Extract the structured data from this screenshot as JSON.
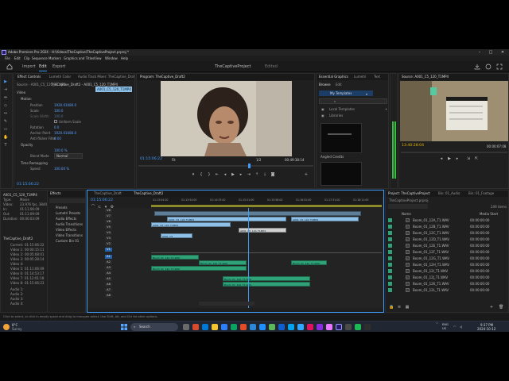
{
  "window": {
    "title": "Adobe Premiere Pro 2024 - H:\\Videos\\TheCaptive\\TheCaptiveProject.prproj *",
    "controls": [
      "–",
      "□",
      "✕"
    ]
  },
  "menu": [
    "File",
    "Edit",
    "Clip",
    "Sequence",
    "Markers",
    "Graphics and Titles",
    "View",
    "Window",
    "Help"
  ],
  "workspace": {
    "tabs": [
      "Import",
      "Edit",
      "Export"
    ],
    "active": "Edit",
    "project_title": "TheCaptiveProject",
    "status": "Edited"
  },
  "effect_controls": {
    "tabs": [
      "Effect Controls",
      "Lumetri Color",
      "Audio Track Mixer: TheCaptive_Draft"
    ],
    "source_label": "Source - A001_C5_120_T1.MP4",
    "sequence_label": "TheCaptive_Draft2 - A001_C5_120_T1MP4",
    "clip_name": "A001_C5_120_T1MP4",
    "section_video": "Video",
    "motion_label": "Motion",
    "rows": [
      {
        "label": "Position",
        "value": "1920.0",
        "value2": "1080.0"
      },
      {
        "label": "Scale",
        "value": "100.0"
      },
      {
        "label": "Scale Width",
        "value": "100.0"
      },
      {
        "label": "Uniform Scale",
        "value": ""
      },
      {
        "label": "Rotation",
        "value": "0.0"
      },
      {
        "label": "Anchor Point",
        "value": "1920.0",
        "value2": "1080.0"
      },
      {
        "label": "Anti-flicker Filter",
        "value": "0.00"
      }
    ],
    "opacity_label": "Opacity",
    "opacity_value": "100.0 %",
    "blend_label": "Blend Mode",
    "blend_value": "Normal",
    "remap_label": "Time Remapping",
    "speed_label": "Speed",
    "speed_value": "100.00 %",
    "timecode": "01:15:06:22"
  },
  "program": {
    "tab": "Program: TheCaptive_Draft2",
    "timecode": "01:15:06:22",
    "fit": "Fit",
    "fraction": "1/2",
    "duration": "00:49:38:14"
  },
  "essential_graphics": {
    "tabs": [
      "Essential Graphics",
      "Lumetri",
      "Text"
    ],
    "sub_tabs": [
      "Browse",
      "Edit"
    ],
    "my_templates": "My Templates",
    "folders": [
      "Local Templates",
      "Libraries"
    ],
    "templates": [
      "Angled Credits",
      "Angled Title"
    ]
  },
  "source": {
    "tab": "Source: A001_C5_120_T1MP4",
    "timecode": "13:40:28:04",
    "duration": "00:00:07:08"
  },
  "info": {
    "rows": [
      {
        "label": "A001_C5_120_T1MP4",
        "value": ""
      },
      {
        "label": "Type:",
        "value": "Movie"
      },
      {
        "label": "Video:",
        "value": "23.976 fps, 3840x"
      },
      {
        "label": "In:",
        "value": "01:11:06:09"
      },
      {
        "label": "Out:",
        "value": "01:11:09:09"
      },
      {
        "label": "Duration:",
        "value": "00:00:03:09"
      }
    ],
    "sequence_name": "TheCaptive_Draft2",
    "times": [
      {
        "label": "Current:",
        "value": "01:15:06:22"
      },
      {
        "label": "Video 1:",
        "value": "00:00:15:11"
      },
      {
        "label": "Video 2:",
        "value": "00:05:08:01"
      },
      {
        "label": "Video 3:",
        "value": "00:05:28:14"
      },
      {
        "label": "Video 4:",
        "value": ""
      },
      {
        "label": "Video 5:",
        "value": "01:11:06:09"
      },
      {
        "label": "Video 6:",
        "value": "01:14:53:17"
      },
      {
        "label": "Video 7:",
        "value": "01:12:01:18"
      },
      {
        "label": "Video 8:",
        "value": "01:15:06:23"
      },
      {
        "label": "Audio 1:",
        "value": ""
      },
      {
        "label": "Audio 2:",
        "value": ""
      },
      {
        "label": "Audio 3:",
        "value": ""
      },
      {
        "label": "Audio 4:",
        "value": ""
      }
    ]
  },
  "effects": {
    "tab": "Effects",
    "items": [
      "Presets",
      "Lumetri Presets",
      "Audio Effects",
      "Audio Transitions",
      "Video Effects",
      "Video Transitions",
      "Custom Bin 01"
    ]
  },
  "timeline": {
    "tabs": [
      "TheCaptive_Draft",
      "TheCaptive_Draft2"
    ],
    "timecode": "01:15:06:22",
    "ruler": [
      "01:13:04:20",
      "01:13:54:00",
      "01:14:33:00",
      "01:15:21:00",
      "01:15:58:00",
      "01:16:52:00",
      "01:17:31:00",
      "01:18:11:00"
    ],
    "video_tracks": [
      "V8",
      "V7",
      "V6",
      "V5",
      "V4",
      "V3",
      "V2",
      "V1"
    ],
    "audio_tracks": [
      "A1",
      "A2",
      "A3",
      "A4",
      "A5",
      "A6",
      "A7",
      "A8"
    ],
    "clips": [
      {
        "label": "",
        "kind": "v"
      },
      {
        "label": "A001_C5_120_T1MP4",
        "kind": "v"
      },
      {
        "label": "A001_C5_120_T1MP4",
        "kind": "v"
      },
      {
        "label": "A001_C5_120_T1MP4",
        "kind": "v"
      },
      {
        "label": "A001_C5_120_T1MP4",
        "kind": "v"
      },
      {
        "label": "A001_C5",
        "kind": "v"
      },
      {
        "label": "Boom_01_12A_T1.WAV",
        "kind": "a"
      },
      {
        "label": "Boom_01_12A_T1.WAV",
        "kind": "a"
      },
      {
        "label": "Boom_01_12A_T1.WAV",
        "kind": "a"
      },
      {
        "label": "Boom_01_12A_T1.WAV",
        "kind": "a"
      },
      {
        "label": "Boom_01_12A_T1.WAV",
        "kind": "a"
      },
      {
        "label": "Boom_01_12A_T1.WAV",
        "kind": "a"
      }
    ]
  },
  "project": {
    "tabs": [
      "Project: TheCaptiveProject",
      "Bin: 01_Audio",
      "Bin: 01_Footage"
    ],
    "path": "TheCaptiveProject.prproj",
    "count": "249 items",
    "col_name": "Name",
    "col_start": "Media Start",
    "items": [
      {
        "name": "Boom_01_12A_T1.WAV",
        "start": "00:00:00:00"
      },
      {
        "name": "Boom_01_12B_T1.WAV",
        "start": "00:00:00:00"
      },
      {
        "name": "Boom_01_12C_T1.WAV",
        "start": "00:00:00:00"
      },
      {
        "name": "Boom_01_12D_T1.WAV",
        "start": "00:00:00:00"
      },
      {
        "name": "Boom_01_12E_T1.WAV",
        "start": "00:00:00:00"
      },
      {
        "name": "Boom_01_12F_T1.WAV",
        "start": "00:00:00:00"
      },
      {
        "name": "Boom_01_12G_T1.WAV",
        "start": "00:00:00:00"
      },
      {
        "name": "Boom_01_12H_T1.WAV",
        "start": "00:00:00:00"
      },
      {
        "name": "Boom_01_12I_T1.WAV",
        "start": "00:00:00:00"
      },
      {
        "name": "Boom_01_12J_T1.WAV",
        "start": "00:00:00:00"
      },
      {
        "name": "Boom_01_12K_T1.WAV",
        "start": "00:00:00:00"
      },
      {
        "name": "Boom_01_12L_T1.WAV",
        "start": "00:00:00:00"
      }
    ]
  },
  "status_bar": "Click to select, or click in empty space and drag to marquee select. Use Shift, Alt, and Ctrl for other options.",
  "taskbar": {
    "weather_temp": "8°C",
    "weather_text": "Sunny",
    "search": "Search",
    "lang": "ENG",
    "region": "US",
    "time": "9:37 PM",
    "date": "2024-10-12"
  },
  "colors": {
    "accent": "#3f9cff",
    "video_clip": "#8fc1e8",
    "audio_clip": "#2fa377",
    "panel_bg": "#1f1f1f"
  }
}
